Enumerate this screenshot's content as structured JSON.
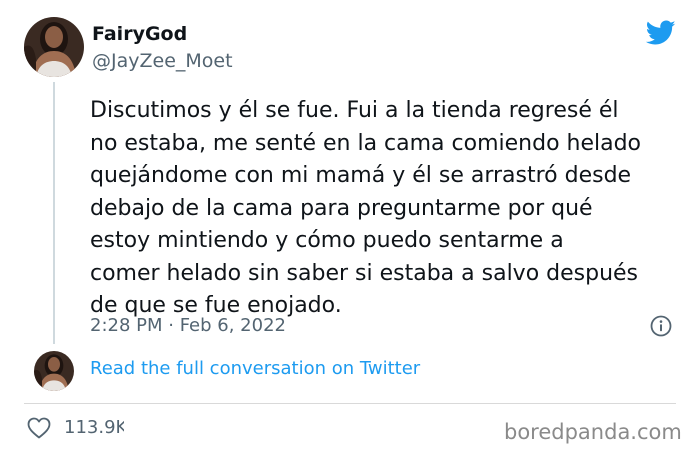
{
  "tweet": {
    "display_name": "FairyGod",
    "handle": "@JayZee_Moet",
    "text_lines": [
      "Discutimos y él se fue. Fui a la tienda regresé él",
      "no estaba, me senté en la cama comiendo helado",
      "quejándome con mi mamá y él se arrastró desde",
      "debajo de la cama para preguntarme por qué",
      "estoy mintiendo y cómo puedo sentarme a",
      "comer helado sin saber si estaba a salvo después",
      "de que se fue enojado."
    ],
    "timestamp": "2:28 PM · Feb 6, 2022",
    "read_more_label": "Read the full conversation on Twitter",
    "like_count": "113.9K"
  },
  "watermark": "boredpanda.com",
  "icons": {
    "brand": "twitter-bird-icon",
    "info": "info-icon",
    "like": "heart-icon"
  },
  "colors": {
    "twitter_blue": "#1d9bf0",
    "text_primary": "#0f1419",
    "text_secondary": "#536471"
  }
}
